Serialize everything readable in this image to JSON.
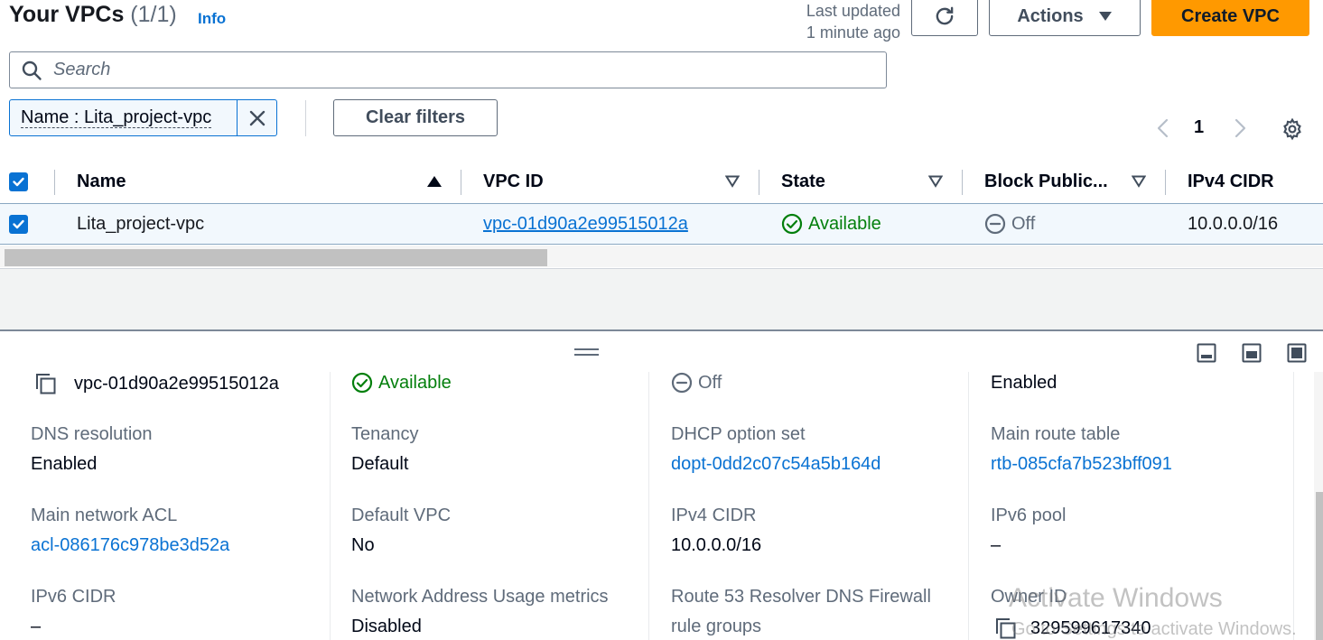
{
  "header": {
    "title": "Your VPCs",
    "count": "(1/1)",
    "info": "Info",
    "last_updated_line1": "Last updated",
    "last_updated_line2": "1 minute ago",
    "actions_label": "Actions",
    "create_label": "Create VPC"
  },
  "search": {
    "placeholder": "Search"
  },
  "filter": {
    "token": "Name : Lita_project-vpc",
    "clear_label": "Clear filters"
  },
  "pagination": {
    "current": "1"
  },
  "table": {
    "columns": [
      "Name",
      "VPC ID",
      "State",
      "Block Public...",
      "IPv4 CIDR"
    ],
    "rows": [
      {
        "name": "Lita_project-vpc",
        "vpc_id": "vpc-01d90a2e99515012a",
        "state": "Available",
        "block_public": "Off",
        "ipv4_cidr": "10.0.0.0/16"
      }
    ]
  },
  "details": {
    "top": {
      "vpc_id": "vpc-01d90a2e99515012a",
      "state": "Available",
      "block_public": "Off",
      "dns_hostnames": "Enabled"
    },
    "fields": [
      {
        "label": "DNS resolution",
        "value": "Enabled",
        "link": false
      },
      {
        "label": "Tenancy",
        "value": "Default",
        "link": false
      },
      {
        "label": "DHCP option set",
        "value": "dopt-0dd2c07c54a5b164d",
        "link": true
      },
      {
        "label": "Main route table",
        "value": "rtb-085cfa7b523bff091",
        "link": true
      },
      {
        "label": "Main network ACL",
        "value": "acl-086176c978be3d52a",
        "link": true
      },
      {
        "label": "Default VPC",
        "value": "No",
        "link": false
      },
      {
        "label": "IPv4 CIDR",
        "value": "10.0.0.0/16",
        "link": false
      },
      {
        "label": "IPv6 pool",
        "value": "–",
        "link": false
      },
      {
        "label": "IPv6 CIDR",
        "value": "–",
        "link": false
      },
      {
        "label": "Network Address Usage metrics",
        "value": "Disabled",
        "link": false
      },
      {
        "label": "Route 53 Resolver DNS Firewall",
        "value": "rule groups",
        "link": false
      },
      {
        "label": "Owner ID",
        "value": "329599617340",
        "link": false
      }
    ]
  },
  "watermark": {
    "line1": "Activate Windows",
    "line2": "Go to Settings to activate Windows."
  },
  "colors": {
    "primary": "#0972d3",
    "accent": "#ff9900",
    "success": "#037f0c",
    "text": "#000716",
    "muted": "#5f6b7a"
  },
  "icons": [
    "refresh-icon",
    "caret-down-icon",
    "search-icon",
    "close-icon",
    "chevron-left-icon",
    "chevron-right-icon",
    "gear-icon",
    "sort-asc-icon",
    "sort-desc-icon",
    "check-circle-icon",
    "minus-circle-icon",
    "copy-icon",
    "drag-handle-icon",
    "layout-icons"
  ]
}
